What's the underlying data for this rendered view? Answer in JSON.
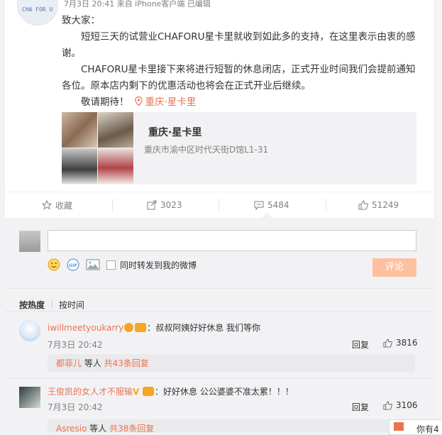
{
  "post": {
    "avatar_text": "CHA FOR U",
    "meta": "7月3日 20:41 来自 iPhone客户端 已编辑",
    "paragraphs": [
      "致大家：",
      "短短三天的试营业CHAFORU星卡里就收到如此多的支持，在这里表示由衷的感谢。",
      "CHAFORU星卡里接下来将进行短暂的休息闭店，正式开业时间我们会提前通知各位。原本店内剩下的优惠活动也将会在正式开业后继续。",
      "敬请期待！"
    ],
    "location_link": "重庆·星卡里",
    "location_card": {
      "title": "重庆·星卡里",
      "address": "重庆市渝中区时代天街D馆L1-31"
    }
  },
  "actions": {
    "favorite": "收藏",
    "forward_count": "3023",
    "comment_count": "5484",
    "like_count": "51249"
  },
  "comment_box": {
    "also_forward_label": "同时转发到我的微博",
    "submit_label": "评论"
  },
  "sort": {
    "hot": "按热度",
    "time": "按时间"
  },
  "comments": [
    {
      "user": "iwillmeetyoukarry",
      "text": "：叔叔阿姨好好休息 我们等你",
      "time": "7月3日 20:42",
      "reply_label": "回复",
      "likes": "3816",
      "sub_user": "都菲儿",
      "sub_mid": " 等人 ",
      "sub_count": "共43条回复"
    },
    {
      "user": "王俊凯的女人才不服输",
      "text": "：好好休息 公公婆婆不准太累！！！",
      "time": "7月3日 20:42",
      "reply_label": "回复",
      "likes": "3106",
      "sub_user": "Asresio",
      "sub_mid": " 等人 ",
      "sub_count": "共38条回复"
    }
  ],
  "notification": {
    "text": "你有4"
  }
}
